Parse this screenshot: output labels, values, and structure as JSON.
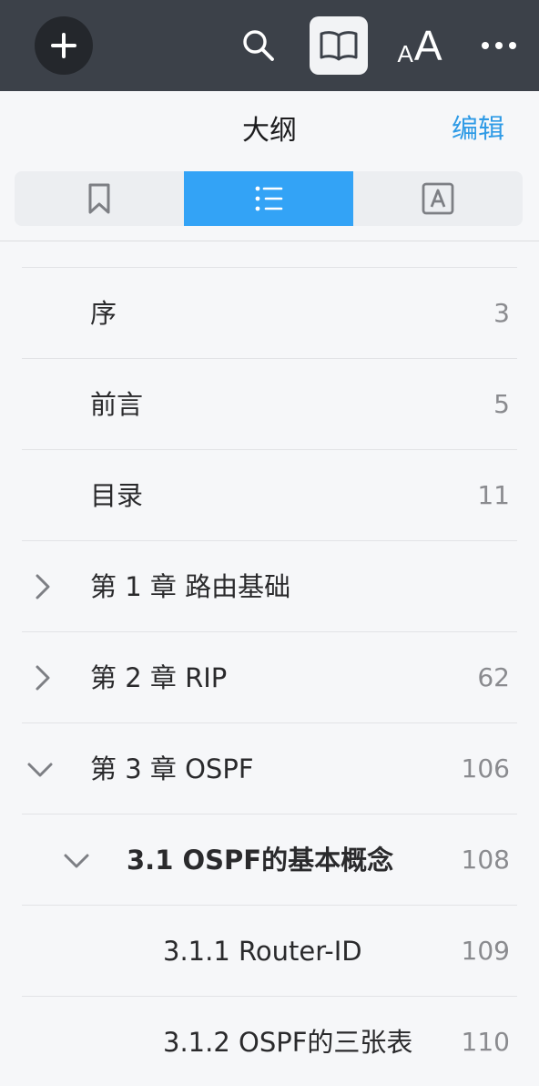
{
  "toolbar": {
    "add_icon": "plus-icon",
    "search_icon": "search-icon",
    "book_icon": "book-icon",
    "font_small": "A",
    "font_large": "A",
    "more_icon": "more-icon",
    "background": "#3c4149"
  },
  "panel": {
    "title": "大纲",
    "edit_label": "编辑",
    "accent": "#2f9be6",
    "segments": [
      {
        "icon": "bookmark-icon",
        "selected": false
      },
      {
        "icon": "outline-list-icon",
        "selected": true
      },
      {
        "icon": "annotation-icon",
        "selected": false
      }
    ]
  },
  "outline": {
    "items": [
      {
        "label": "序",
        "page": "3",
        "expand": "none",
        "level": 0
      },
      {
        "label": "前言",
        "page": "5",
        "expand": "none",
        "level": 0
      },
      {
        "label": "目录",
        "page": "11",
        "expand": "none",
        "level": 0
      },
      {
        "label": "第 1 章 路由基础",
        "page": "",
        "expand": "collapsed",
        "level": 0
      },
      {
        "label": "第 2 章 RIP",
        "page": "62",
        "expand": "collapsed",
        "level": 0
      },
      {
        "label": "第 3 章 OSPF",
        "page": "106",
        "expand": "expanded",
        "level": 0
      },
      {
        "label": "3.1 OSPF的基本概念",
        "page": "108",
        "expand": "expanded",
        "level": 1
      },
      {
        "label": "3.1.1 Router-ID",
        "page": "109",
        "expand": "none",
        "level": 2
      },
      {
        "label": "3.1.2 OSPF的三张表",
        "page": "110",
        "expand": "none",
        "level": 2
      }
    ]
  }
}
